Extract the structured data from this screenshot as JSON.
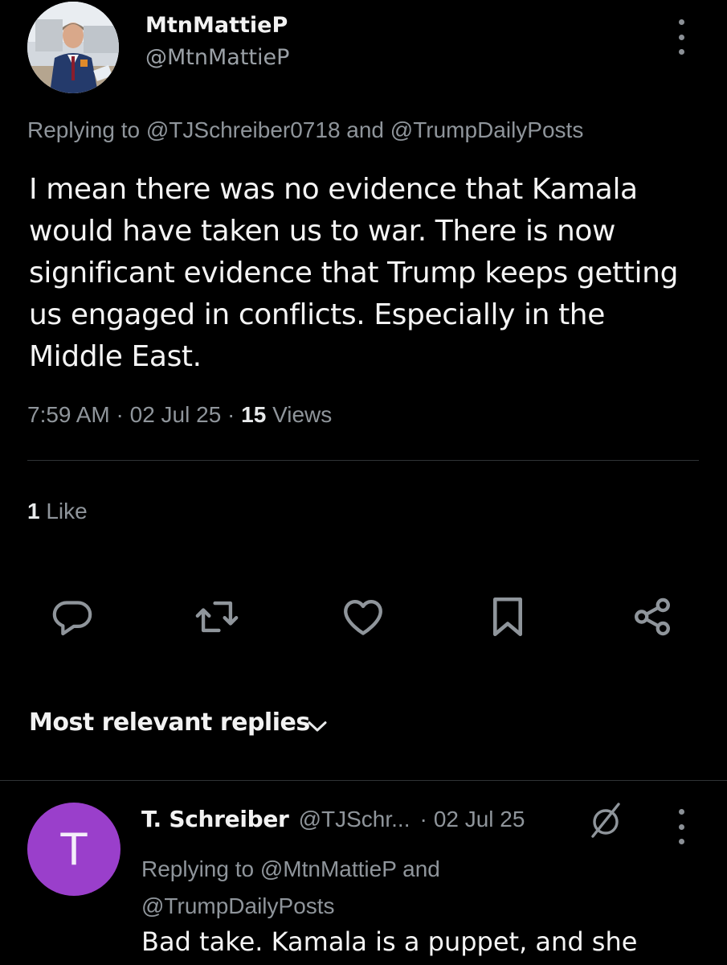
{
  "main_tweet": {
    "author_name": "MtnMattieP",
    "author_handle": "@MtnMattieP",
    "replying_to": "Replying to @TJSchreiber0718 and @TrumpDailyPosts",
    "text": "I mean there was no evidence that Kamala would have taken us to war. There is now significant evidence that Trump keeps getting us engaged in conflicts. Especially in the Middle East.",
    "time": "7:59 AM",
    "date": "02 Jul 25",
    "views_count": "15",
    "views_label": "Views",
    "likes_count": "1",
    "likes_label": "Like"
  },
  "actions": {
    "reply_icon": "comment-bubble-icon",
    "retweet_icon": "retweet-icon",
    "like_icon": "heart-icon",
    "bookmark_icon": "bookmark-icon",
    "share_icon": "share-icon"
  },
  "sort": {
    "label": "Most relevant replies"
  },
  "reply": {
    "avatar_letter": "T",
    "author_name": "T. Schreiber",
    "author_handle": "@TJSchr...",
    "separator": "·",
    "date": "02 Jul 25",
    "replying_to": "Replying to @MtnMattieP and @TrumpDailyPosts",
    "text": "Bad take. Kamala is a puppet, and she"
  },
  "colors": {
    "background": "#000000",
    "text_primary": "#e7e9ea",
    "text_secondary": "#8f959b",
    "divider": "#2f3336",
    "reply_avatar": "#9a3fcb"
  }
}
